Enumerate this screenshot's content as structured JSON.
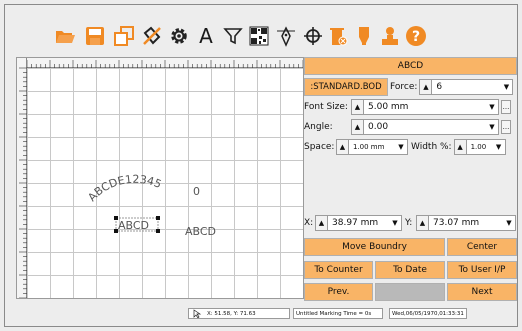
{
  "toolbar": {
    "icons": [
      "open-folder-icon",
      "save-icon",
      "copy-icon",
      "delete-icon",
      "settings-gear-icon",
      "text-tool-icon",
      "funnel-icon",
      "qr-code-icon",
      "pen-tool-icon",
      "crosshair-icon",
      "trash-bin-icon",
      "stamp-pin-icon",
      "user-stamp-icon",
      "help-icon"
    ],
    "text_tool_glyph": "A",
    "accent": "#f08a24"
  },
  "canvas": {
    "arc_text": "ABCDE12345",
    "zero_text": "0",
    "selected_text": "ABCD",
    "plain_text": "ABCD"
  },
  "panel": {
    "header": "ABCD",
    "font_file": ":STANDARD.BOD",
    "force_label": "Force:",
    "force_value": "6",
    "font_size_label": "Font Size:",
    "font_size_value": "5.00 mm",
    "angle_label": "Angle:",
    "angle_value": "0.00",
    "space_label": "Space:",
    "space_value": "1.00 mm",
    "width_label": "Width %:",
    "width_value": "1.00",
    "x_label": "X:",
    "x_value": "38.97 mm",
    "y_label": "Y:",
    "y_value": "73.07 mm",
    "move_boundary": "Move Boundry",
    "center": "Center",
    "to_counter": "To Counter",
    "to_date": "To Date",
    "to_user": "To User I/P",
    "prev": "Prev.",
    "next": "Next",
    "ellipsis": "..."
  },
  "status": {
    "coords": "X: 51.58, Y: 71.63",
    "file": "Untitled",
    "marking_time": "Marking Time = 0s",
    "datetime": "Wed,06/05/1970,01:33:31"
  }
}
